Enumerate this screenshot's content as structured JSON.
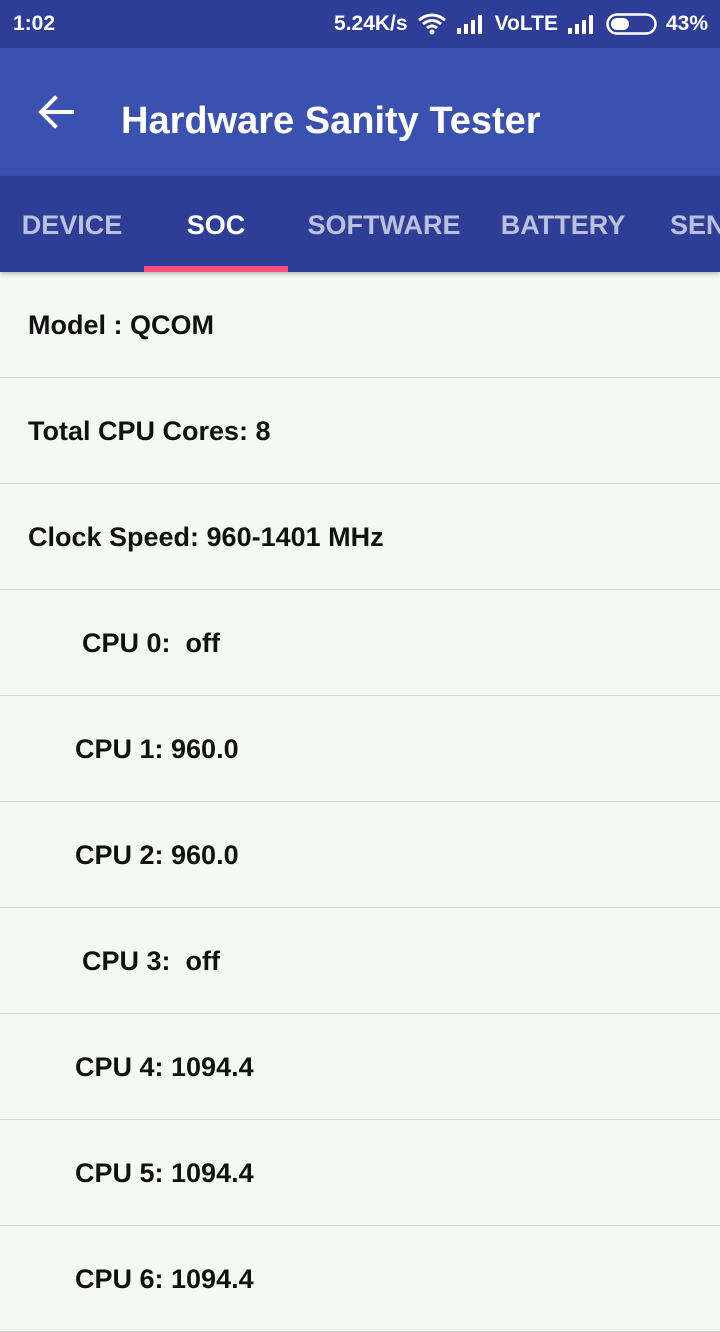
{
  "status_bar": {
    "time": "1:02",
    "net_speed": "5.24K/s",
    "volte": "VoLTE",
    "battery_percent": "43%",
    "battery_level": 0.43
  },
  "toolbar": {
    "title": "Hardware Sanity Tester"
  },
  "tabs": {
    "items": [
      "DEVICE",
      "SOC",
      "SOFTWARE",
      "BATTERY",
      "SEN"
    ],
    "active": "SOC",
    "indicator_color": "#ff4f81"
  },
  "soc": {
    "rows": [
      "Model : QCOM",
      "Total CPU Cores: 8",
      "Clock Speed: 960-1401 MHz",
      "CPU 0:  off",
      "CPU 1: 960.0",
      "CPU 2: 960.0",
      "CPU 3:  off",
      "CPU 4: 1094.4",
      "CPU 5: 1094.4",
      "CPU 6: 1094.4"
    ]
  },
  "colors": {
    "primary": "#3a51b0",
    "primary_dark": "#2e3e96",
    "background": "#f5f9f4"
  }
}
